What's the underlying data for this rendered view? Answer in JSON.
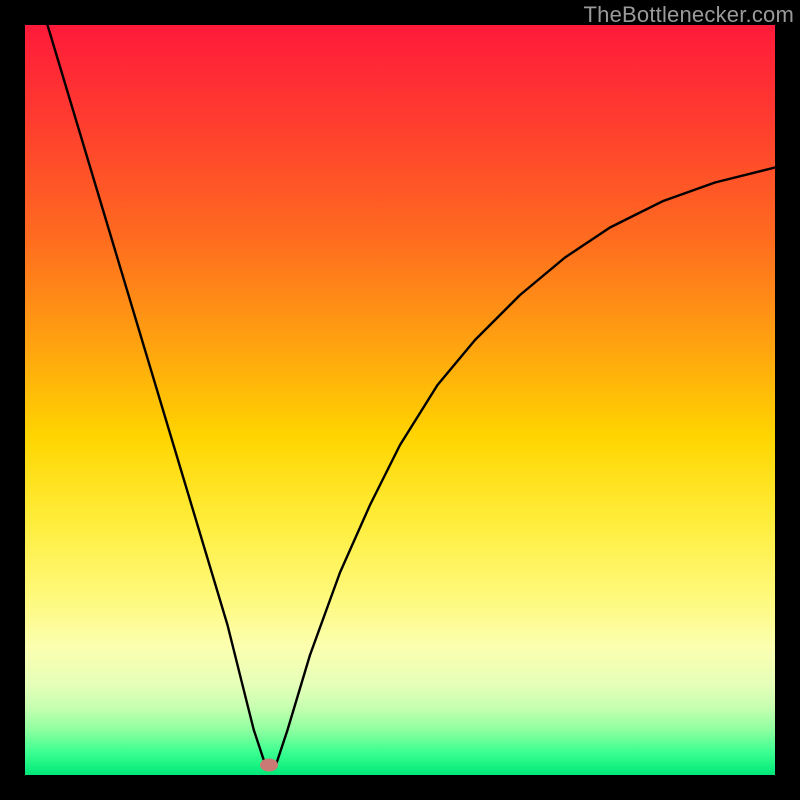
{
  "watermark": "TheBottlenecker.com",
  "marker": {
    "x_pct": 32.5,
    "y_pct": 98.7
  },
  "colors": {
    "frame": "#000000",
    "curve": "#000000",
    "marker": "#c97a74",
    "watermark": "#9a9a9a"
  },
  "chart_data": {
    "type": "line",
    "title": "",
    "xlabel": "",
    "ylabel": "",
    "xlim": [
      0,
      100
    ],
    "ylim": [
      0,
      100
    ],
    "grid": false,
    "legend": false,
    "series": [
      {
        "name": "bottleneck-curve",
        "x": [
          3,
          6,
          9,
          12,
          15,
          18,
          21,
          24,
          27,
          29,
          30.5,
          32,
          33.5,
          35,
          38,
          42,
          46,
          50,
          55,
          60,
          66,
          72,
          78,
          85,
          92,
          100
        ],
        "y": [
          100,
          90,
          80,
          70,
          60,
          50,
          40,
          30,
          20,
          12,
          6,
          1.5,
          1.5,
          6,
          16,
          27,
          36,
          44,
          52,
          58,
          64,
          69,
          73,
          76.5,
          79,
          81
        ]
      }
    ],
    "marker_point": {
      "x": 32.5,
      "y": 1.3
    },
    "gradient_stops": [
      {
        "pct": 0,
        "color": "#ff1a3a"
      },
      {
        "pct": 12,
        "color": "#ff3a30"
      },
      {
        "pct": 28,
        "color": "#ff6a20"
      },
      {
        "pct": 42,
        "color": "#ffa010"
      },
      {
        "pct": 55,
        "color": "#ffd500"
      },
      {
        "pct": 66,
        "color": "#ffed3a"
      },
      {
        "pct": 76,
        "color": "#fff97a"
      },
      {
        "pct": 83,
        "color": "#fbffb0"
      },
      {
        "pct": 88,
        "color": "#e5ffb8"
      },
      {
        "pct": 91,
        "color": "#c6ffb0"
      },
      {
        "pct": 94,
        "color": "#8effa0"
      },
      {
        "pct": 97,
        "color": "#3aff90"
      },
      {
        "pct": 100,
        "color": "#00e878"
      }
    ]
  }
}
